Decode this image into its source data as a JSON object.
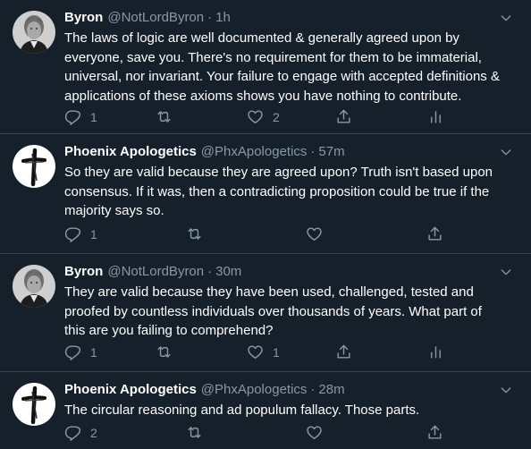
{
  "colors": {
    "background": "#15202b",
    "divider": "#38444d",
    "text": "#ffffff",
    "secondary": "#8899a6"
  },
  "tweets": [
    {
      "avatar": "byron-portrait",
      "name": "Byron",
      "handle": "@NotLordByron",
      "separator": "·",
      "time": "1h",
      "lines": [
        "The laws of logic are well documented & generally agreed upon by",
        "everyone, save you. There's no requirement for them to be immaterial,",
        "universal, nor invariant. Your failure to engage with accepted definitions &",
        "applications of these axioms shows you have nothing to contribute."
      ],
      "reply_count": "1",
      "retweet_count": "",
      "like_count": "2",
      "show_analytics": true
    },
    {
      "avatar": "cross",
      "name": "Phoenix Apologetics",
      "handle": "@PhxApologetics",
      "separator": "·",
      "time": "57m",
      "lines": [
        "So they are valid because they are agreed upon?  Truth isn't based upon",
        "consensus. If it was, then a contradicting proposition could be true if the",
        "majority says so."
      ],
      "reply_count": "1",
      "retweet_count": "",
      "like_count": "",
      "show_analytics": false
    },
    {
      "avatar": "byron-portrait",
      "name": "Byron",
      "handle": "@NotLordByron",
      "separator": "·",
      "time": "30m",
      "lines": [
        "They are valid because they have been used, challenged, tested and",
        "proofed by countless individuals over thousands of years. What part of",
        "this are you failing to comprehend?"
      ],
      "reply_count": "1",
      "retweet_count": "",
      "like_count": "1",
      "show_analytics": true
    },
    {
      "avatar": "cross",
      "name": "Phoenix Apologetics",
      "handle": "@PhxApologetics",
      "separator": "·",
      "time": "28m",
      "lines": [
        "The circular reasoning and ad populum fallacy. Those parts."
      ],
      "reply_count": "2",
      "retweet_count": "",
      "like_count": "",
      "show_analytics": false
    }
  ]
}
